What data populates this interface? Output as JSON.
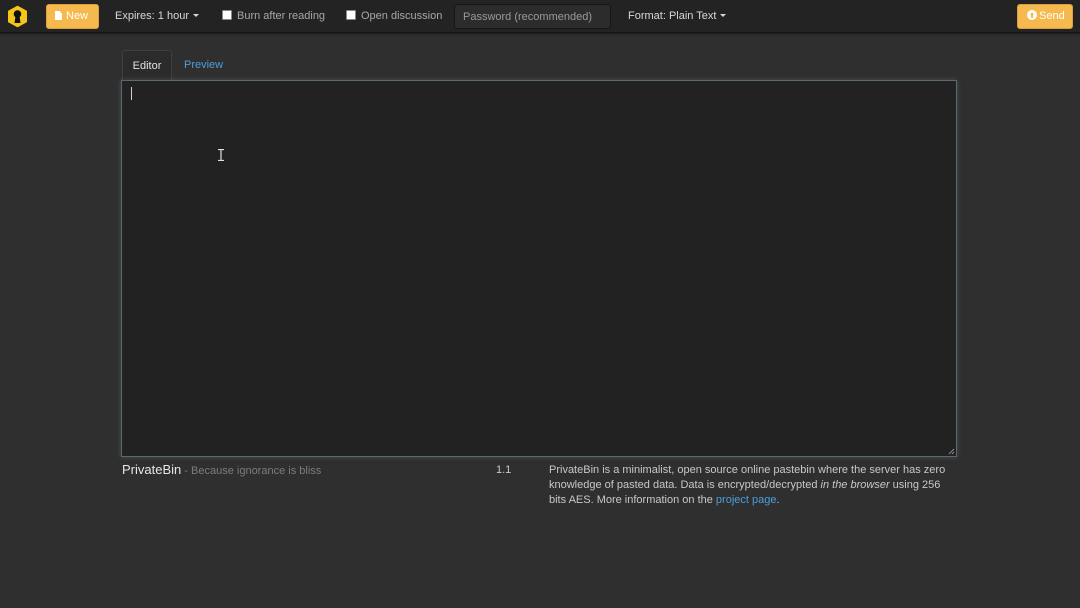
{
  "navbar": {
    "new_label": "New",
    "expires_label": "Expires: 1 hour",
    "burn_label": "Burn after reading",
    "discussion_label": "Open discussion",
    "password_placeholder": "Password (recommended)",
    "password_value": "",
    "format_label": "Format: Plain Text",
    "send_label": "Send"
  },
  "tabs": [
    {
      "label": "Editor"
    },
    {
      "label": "Preview"
    }
  ],
  "editor": {
    "content": ""
  },
  "footer": {
    "brand": "PrivateBin",
    "tagline": " - Because ignorance is bliss",
    "version": "1.1",
    "about_part1": "PrivateBin is a minimalist, open source online pastebin where the server has zero knowledge of pasted data. Data is encrypted/decrypted ",
    "about_em": "in the browser",
    "about_part2": " using 256 bits AES. More information on the ",
    "about_link": "project page",
    "about_end": "."
  },
  "icons": {
    "logo": "keyhole-logo-icon",
    "new": "document-icon",
    "send": "circle-arrow-up-icon"
  },
  "colors": {
    "accent": "#f5b94e",
    "link": "#4a9fdb",
    "background": "#302f2f",
    "navbar": "#232323"
  }
}
